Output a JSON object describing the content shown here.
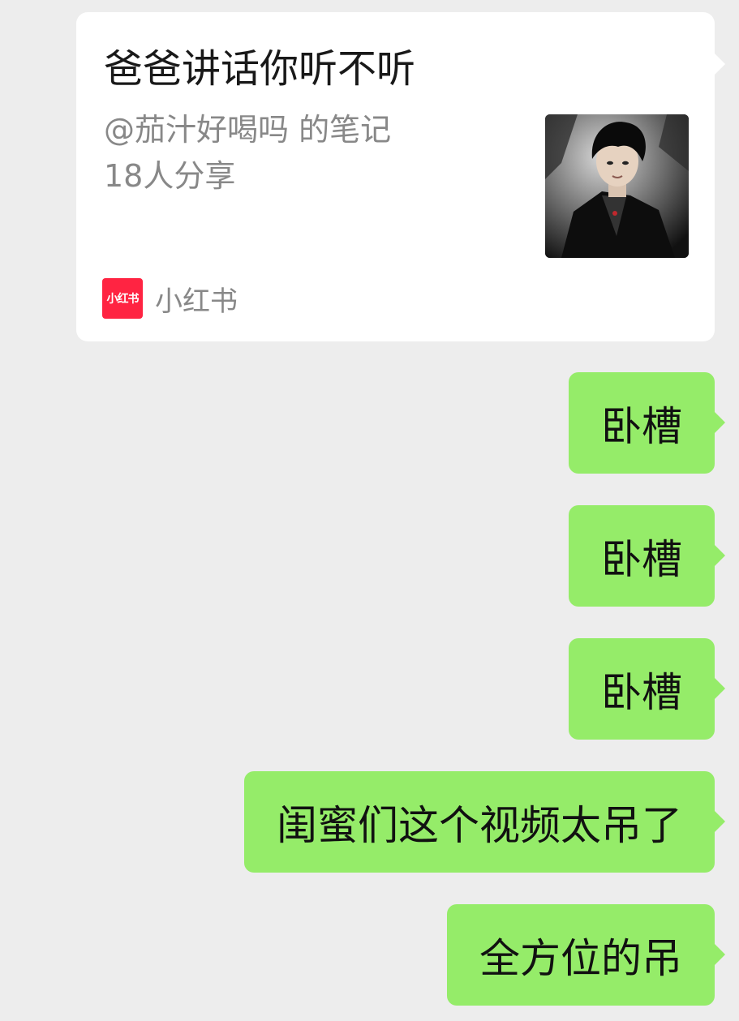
{
  "share_card": {
    "title": "爸爸讲话你听不听",
    "author_line": "@茄汁好喝吗 的笔记",
    "share_count": "18人分享",
    "source_logo_text": "小红书",
    "source_name": "小红书",
    "thumbnail_icon": "person-photo"
  },
  "messages": [
    {
      "text": "卧槽",
      "side": "right"
    },
    {
      "text": "卧槽",
      "side": "right"
    },
    {
      "text": "卧槽",
      "side": "right"
    },
    {
      "text": "闺蜜们这个视频太吊了",
      "side": "right"
    },
    {
      "text": "全方位的吊",
      "side": "right"
    }
  ],
  "colors": {
    "background": "#ededed",
    "card": "#ffffff",
    "outgoing_bubble": "#95ec69",
    "brand_red": "#ff2442"
  }
}
